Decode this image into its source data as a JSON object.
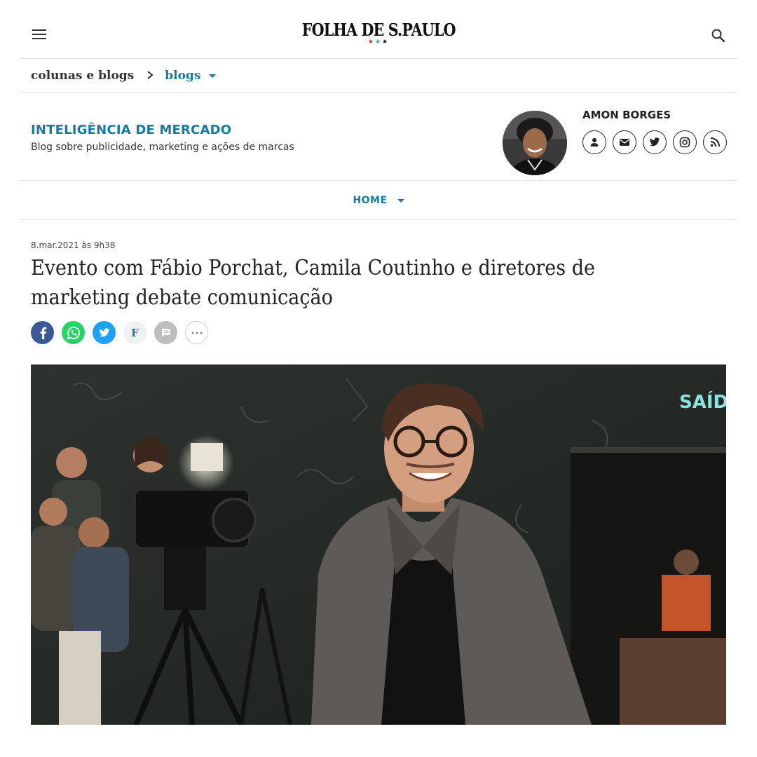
{
  "header": {
    "logo": "FOLHA DE S.PAULO",
    "logo_stars": [
      "★",
      "★",
      "★"
    ]
  },
  "breadcrumb": {
    "section": "colunas e blogs",
    "current": "blogs"
  },
  "blog": {
    "title": "INTELIGÊNCIA DE MERCADO",
    "subtitle": "Blog sobre publicidade, marketing e ações de marcas"
  },
  "author": {
    "name": "AMON BORGES",
    "links": [
      "person-icon",
      "mail-icon",
      "twitter-icon",
      "instagram-icon",
      "rss-icon"
    ]
  },
  "nav": {
    "home": "HOME"
  },
  "article": {
    "date": "8.mar.2021 às 9h38",
    "headline": "Evento com Fábio Porchat, Camila Coutinho e diretores de marketing debate comunicação",
    "share": [
      "facebook-icon",
      "whatsapp-icon",
      "twitter-icon",
      "folha-icon",
      "comment-icon",
      "more-icon"
    ],
    "share_f_letter": "F",
    "photo_sign": "SAÍDA"
  },
  "colors": {
    "accent": "#1a7a9e",
    "facebook": "#3b5998",
    "whatsapp": "#25d366",
    "twitter": "#1da1f2"
  }
}
